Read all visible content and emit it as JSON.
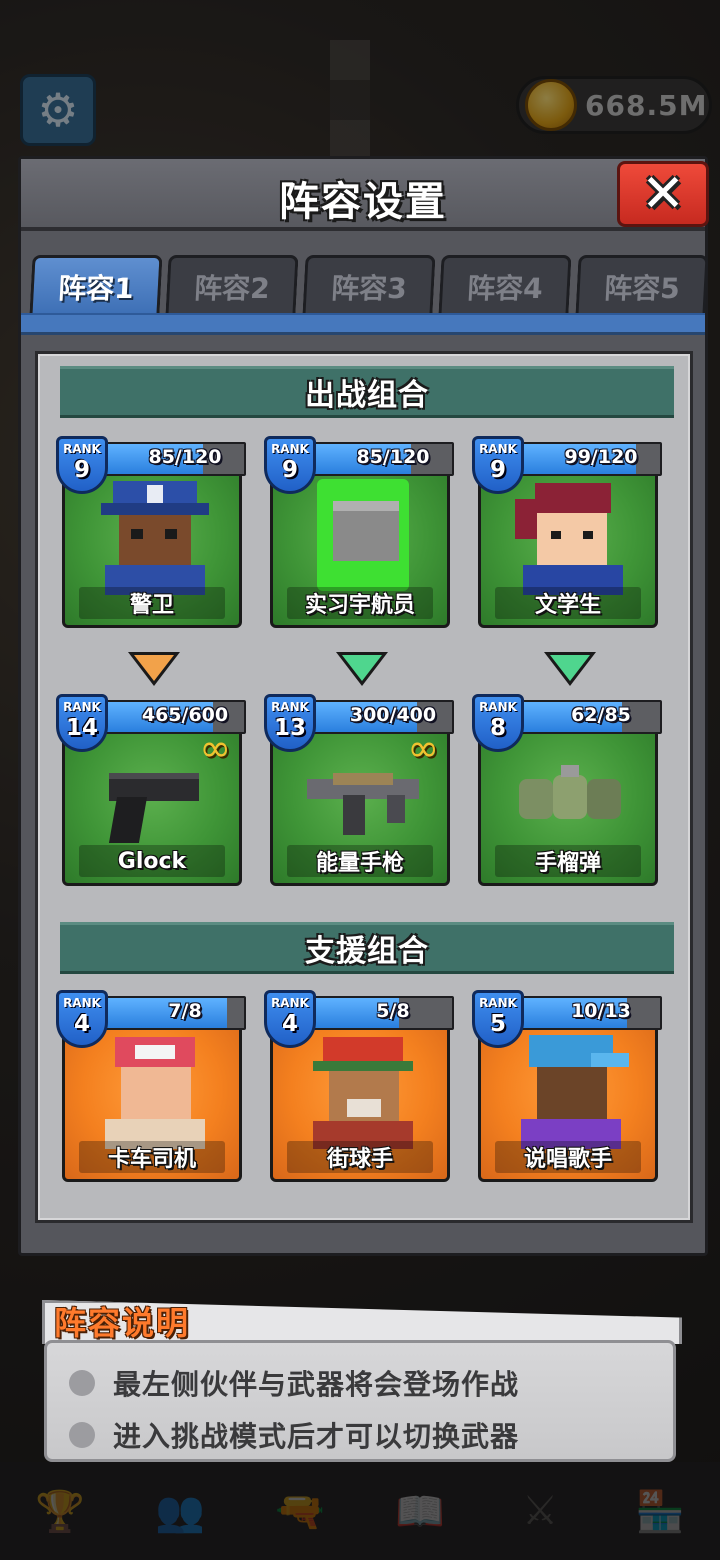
{
  "hud": {
    "settings_icon": "gear-icon",
    "coins": "668.5M"
  },
  "modal": {
    "title": "阵容设置",
    "close_icon": "close-icon"
  },
  "tabs": [
    "阵容1",
    "阵容2",
    "阵容3",
    "阵容4",
    "阵容5"
  ],
  "active_tab_index": 0,
  "battle_section": {
    "title": "出战组合",
    "characters": [
      {
        "rank_label": "RANK",
        "rank": "9",
        "xp": "85/120",
        "name": "警卫",
        "progress": 0.71
      },
      {
        "rank_label": "RANK",
        "rank": "9",
        "xp": "85/120",
        "name": "实习宇航员",
        "progress": 0.71
      },
      {
        "rank_label": "RANK",
        "rank": "9",
        "xp": "99/120",
        "name": "文学生",
        "progress": 0.83
      }
    ],
    "arrows": [
      {
        "color": "#f2a24a"
      },
      {
        "color": "#4fd68e"
      },
      {
        "color": "#4fd68e"
      }
    ],
    "weapons": [
      {
        "rank_label": "RANK",
        "rank": "14",
        "xp": "465/600",
        "name": "Glock",
        "progress": 0.78,
        "infinite": true
      },
      {
        "rank_label": "RANK",
        "rank": "13",
        "xp": "300/400",
        "name": "能量手枪",
        "progress": 0.75,
        "infinite": true
      },
      {
        "rank_label": "RANK",
        "rank": "8",
        "xp": "62/85",
        "name": "手榴弹",
        "progress": 0.73,
        "infinite": false
      }
    ]
  },
  "support_section": {
    "title": "支援组合",
    "characters": [
      {
        "rank_label": "RANK",
        "rank": "4",
        "xp": "7/8",
        "name": "卡车司机",
        "progress": 0.88
      },
      {
        "rank_label": "RANK",
        "rank": "4",
        "xp": "5/8",
        "name": "街球手",
        "progress": 0.63
      },
      {
        "rank_label": "RANK",
        "rank": "5",
        "xp": "10/13",
        "name": "说唱歌手",
        "progress": 0.77
      }
    ]
  },
  "explanation": {
    "title": "阵容说明",
    "lines": [
      "最左侧伙伴与武器将会登场作战",
      "进入挑战模式后才可以切换武器"
    ]
  },
  "bottom_nav": [
    {
      "icon": "trophy-icon"
    },
    {
      "icon": "team-icon"
    },
    {
      "icon": "gun-icon"
    },
    {
      "icon": "book-icon"
    },
    {
      "icon": "crossed-swords-icon"
    },
    {
      "icon": "shop-icon"
    }
  ]
}
